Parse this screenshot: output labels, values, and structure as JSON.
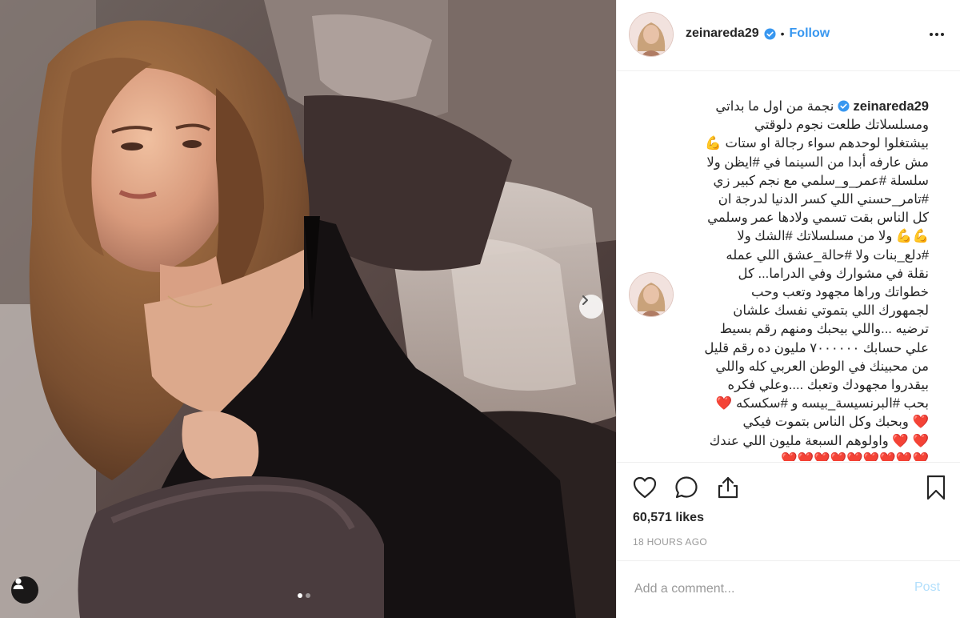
{
  "post": {
    "username": "zeinareda29",
    "verified": true,
    "separator": "•",
    "follow_label": "Follow",
    "more_icon": "more-options-icon"
  },
  "caption": {
    "username": "zeinareda29",
    "lines": [
      "نجمة من اول ما بداتي",
      "ومسلسلاتك طلعت نجوم دلوقتي",
      "بيشتغلوا لوحدهم سواء رجالة او ستات 💪",
      "مش عارفه أبدا من السينما في #ايظن ولا",
      "سلسلة #عمر_و_سلمي مع نجم كبير زي",
      "#تامر_حسني اللي كسر الدنيا لدرجة ان",
      "كل الناس بقت تسمي ولادها عمر وسلمي",
      "💪💪 ولا من مسلسلاتك #الشك ولا",
      "#دلع_بنات ولا #حالة_عشق اللي عمله",
      "نقلة في مشوارك وفي الدراما... كل",
      "خطواتك وراها مجهود وتعب وحب",
      "لجمهورك اللي بتموتي نفسك علشان",
      "ترضيه ...واللي بيحبك ومنهم رقم بسيط",
      "علي حسابك ٧٠٠٠٠٠٠ مليون ده رقم قليل",
      "من محبينك في الوطن العربي كله واللي",
      "بيقدروا مجهودك وتعبك ....وعلي فكره",
      "بحب #البرنسيسة_بيسه و #سكسكه ❤️",
      "❤️ وبحبك وكل الناس بتموت فيكي",
      "❤️ ❤️ واولوهم السبعة مليون اللي عندك",
      "❤️❤️❤️❤️❤️❤️❤️❤️❤️"
    ]
  },
  "actions": {
    "like_icon": "heart-outline-icon",
    "comment_icon": "comment-icon",
    "share_icon": "share-icon",
    "save_icon": "bookmark-icon"
  },
  "likes": "60,571 likes",
  "timestamp": "18 HOURS AGO",
  "comment": {
    "placeholder": "Add a comment...",
    "post_label": "Post"
  },
  "carousel": {
    "total_slides": 2,
    "current_slide": 1,
    "next_icon": "chevron-right-icon",
    "tag_icon": "user-tag-icon"
  },
  "colors": {
    "link": "#3897f0",
    "hashtag": "#003569",
    "muted": "#999999",
    "post_disabled": "#b2dffc",
    "verified": "#3897f0",
    "heart": "#c2182b"
  }
}
